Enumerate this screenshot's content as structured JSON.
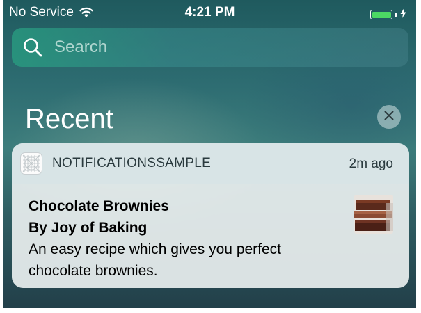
{
  "status_bar": {
    "carrier": "No Service",
    "time": "4:21 PM",
    "battery_color": "#4cd964"
  },
  "search": {
    "placeholder": "Search",
    "icon": "search-icon"
  },
  "recent": {
    "title": "Recent",
    "clear_icon": "close-icon"
  },
  "notification": {
    "app_name": "NOTIFICATIONSSAMPLE",
    "time_ago": "2m ago",
    "title": "Chocolate Brownies",
    "subtitle": "By Joy of Baking",
    "message": "An easy recipe which gives you perfect chocolate brownies.",
    "app_icon": "app-grid-icon",
    "thumbnail": "brownies-thumbnail"
  }
}
